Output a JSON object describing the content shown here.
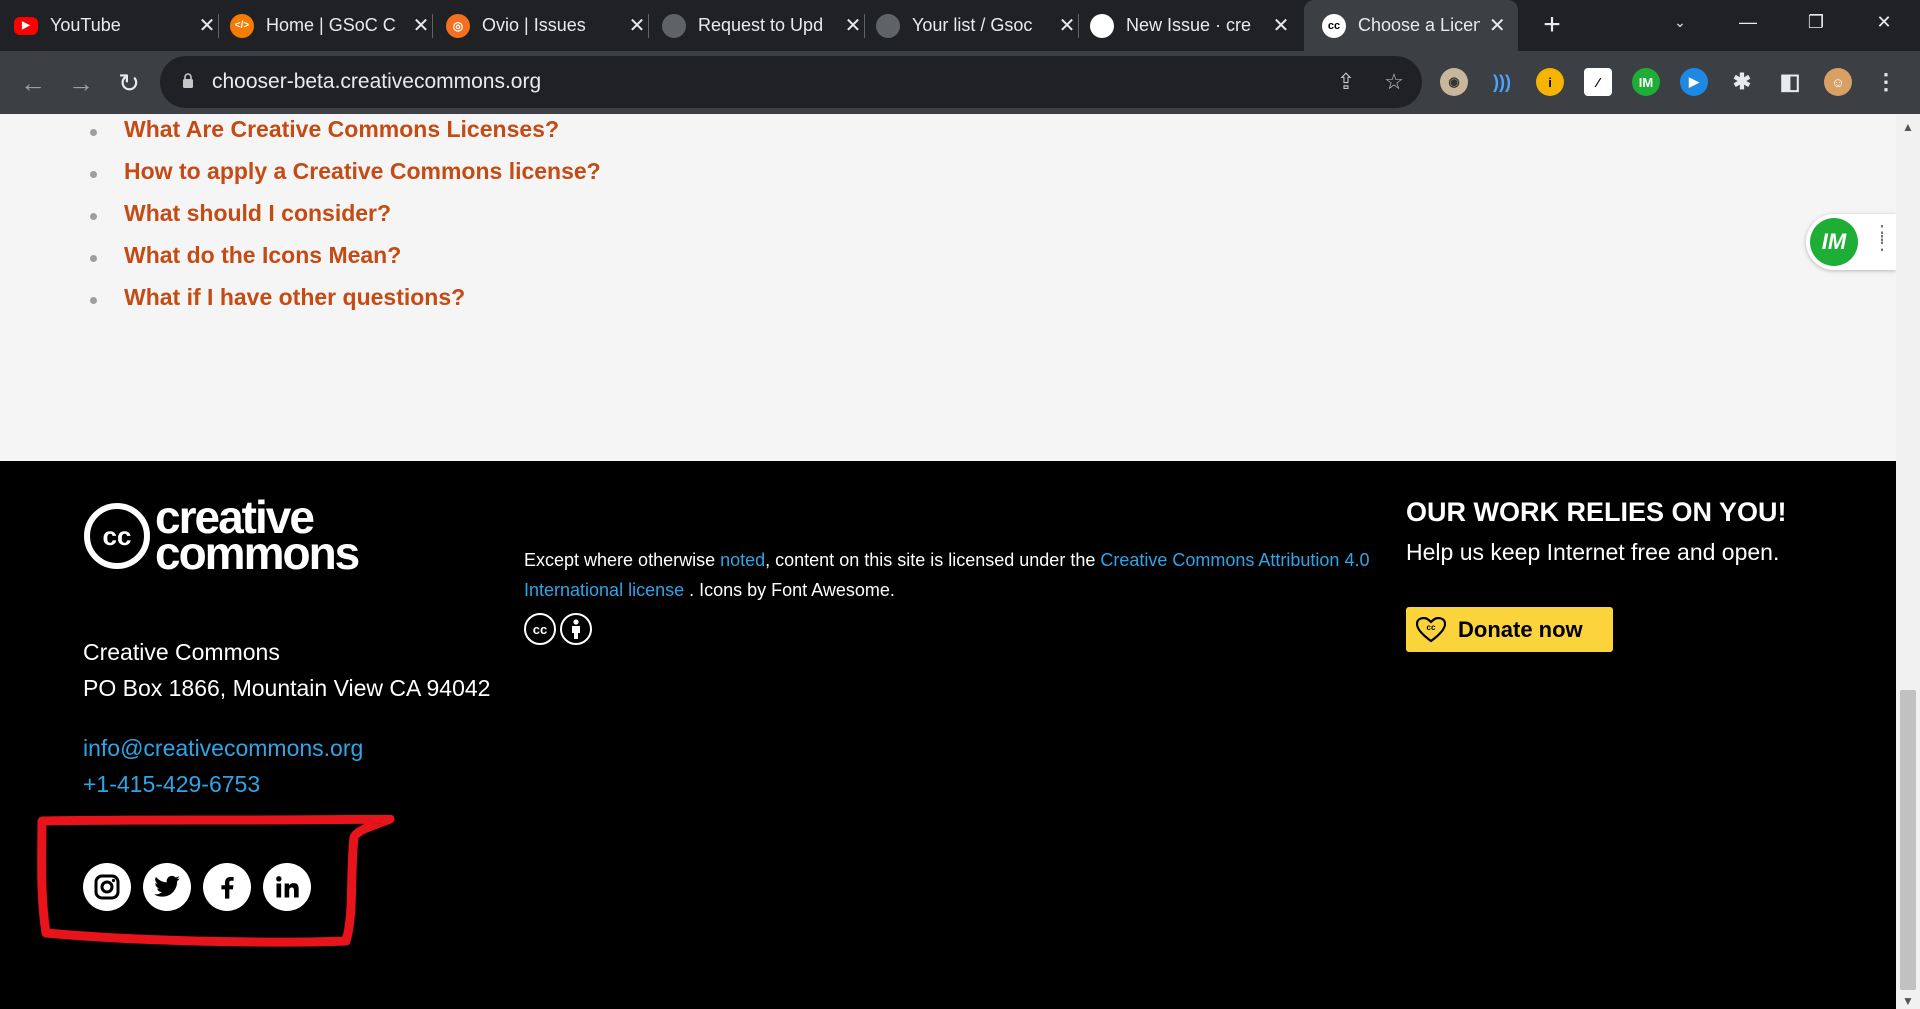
{
  "browser": {
    "tabs": [
      {
        "title": "YouTube",
        "favicon": "youtube-icon",
        "color": "#ff0000",
        "glyph": "▶"
      },
      {
        "title": "Home | GSoC C",
        "favicon": "gsoc-icon",
        "color": "#f57c00",
        "glyph": "</>"
      },
      {
        "title": "Ovio | Issues",
        "favicon": "ovio-icon",
        "color": "#f37021",
        "glyph": "◎"
      },
      {
        "title": "Request to Upd",
        "favicon": "github-icon",
        "color": "#3c3f43",
        "glyph": "●"
      },
      {
        "title": "Your list / Gsoc",
        "favicon": "github-icon",
        "color": "#3c3f43",
        "glyph": "●"
      },
      {
        "title": "New Issue · cre",
        "favicon": "github-icon",
        "color": "#ffffff",
        "glyph": "●"
      },
      {
        "title": "Choose a Licen",
        "favicon": "cc-icon",
        "color": "#ffffff",
        "glyph": "cc"
      }
    ],
    "close_glyph": "✕",
    "new_tab_glyph": "+",
    "url": "chooser-beta.creativecommons.org"
  },
  "faq": {
    "items": [
      "What Are Creative Commons Licenses?",
      "How to apply a Creative Commons license?",
      "What should I consider?",
      "What do the Icons Mean?",
      "What if I have other questions?"
    ]
  },
  "widget": {
    "label": "IM"
  },
  "footer": {
    "logo_text": [
      "creative",
      "commons"
    ],
    "org_name": "Creative Commons",
    "address": "PO Box 1866, Mountain View CA 94042",
    "email": "info@creativecommons.org",
    "phone": "+1-415-429-6753",
    "license_pre": "Except where otherwise ",
    "license_link1": "noted",
    "license_mid": ", content on this site is licensed under the ",
    "license_link2": "Creative Commons Attribution 4.0 International license",
    "license_post": " . Icons by Font Awesome.",
    "donate_heading": "OUR WORK RELIES ON YOU!",
    "donate_sub": "Help us keep Internet free and open.",
    "donate_button": "Donate now",
    "socials": [
      "instagram-icon",
      "twitter-icon",
      "facebook-icon",
      "linkedin-icon"
    ]
  },
  "colors": {
    "link_orange": "#c44b14",
    "link_blue": "#2fa4e7",
    "donate_yellow": "#fbd43c",
    "annotation_red": "#e8141c"
  }
}
